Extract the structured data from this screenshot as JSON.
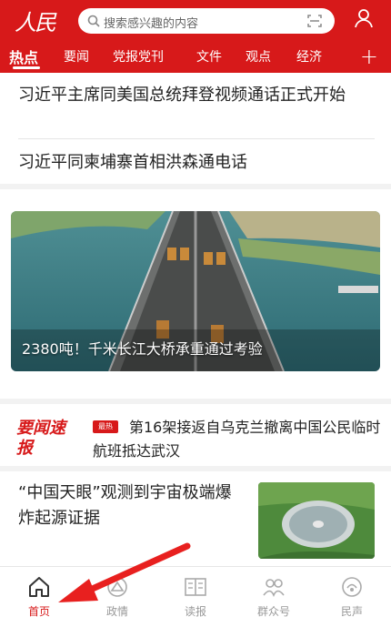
{
  "header": {
    "logo": "人民",
    "search_placeholder": "搜索感兴趣的内容"
  },
  "tabs": [
    "热点",
    "要闻",
    "党报党刊",
    "文件",
    "观点",
    "经济"
  ],
  "tab_plus": "+",
  "headlines": [
    "习近平主席同美国总统拜登视频通话正式开始",
    "习近平同柬埔寨首相洪森通电话"
  ],
  "feature": {
    "caption": "2380吨！千米长江大桥承重通过考验"
  },
  "flash": {
    "title": "要闻速报",
    "badge": "最热",
    "text": "第16架接返自乌克兰撤离中国公民临时航班抵达武汉"
  },
  "news2": {
    "text": "“中国天眼”观测到宇宙极端爆炸起源证据"
  },
  "bottom_nav": [
    {
      "label": "首页",
      "icon": "home-icon"
    },
    {
      "label": "政情",
      "icon": "government-icon"
    },
    {
      "label": "读报",
      "icon": "newspaper-icon"
    },
    {
      "label": "群众号",
      "icon": "people-icon"
    },
    {
      "label": "民声",
      "icon": "voice-icon"
    }
  ],
  "colors": {
    "brand": "#d7191a"
  }
}
